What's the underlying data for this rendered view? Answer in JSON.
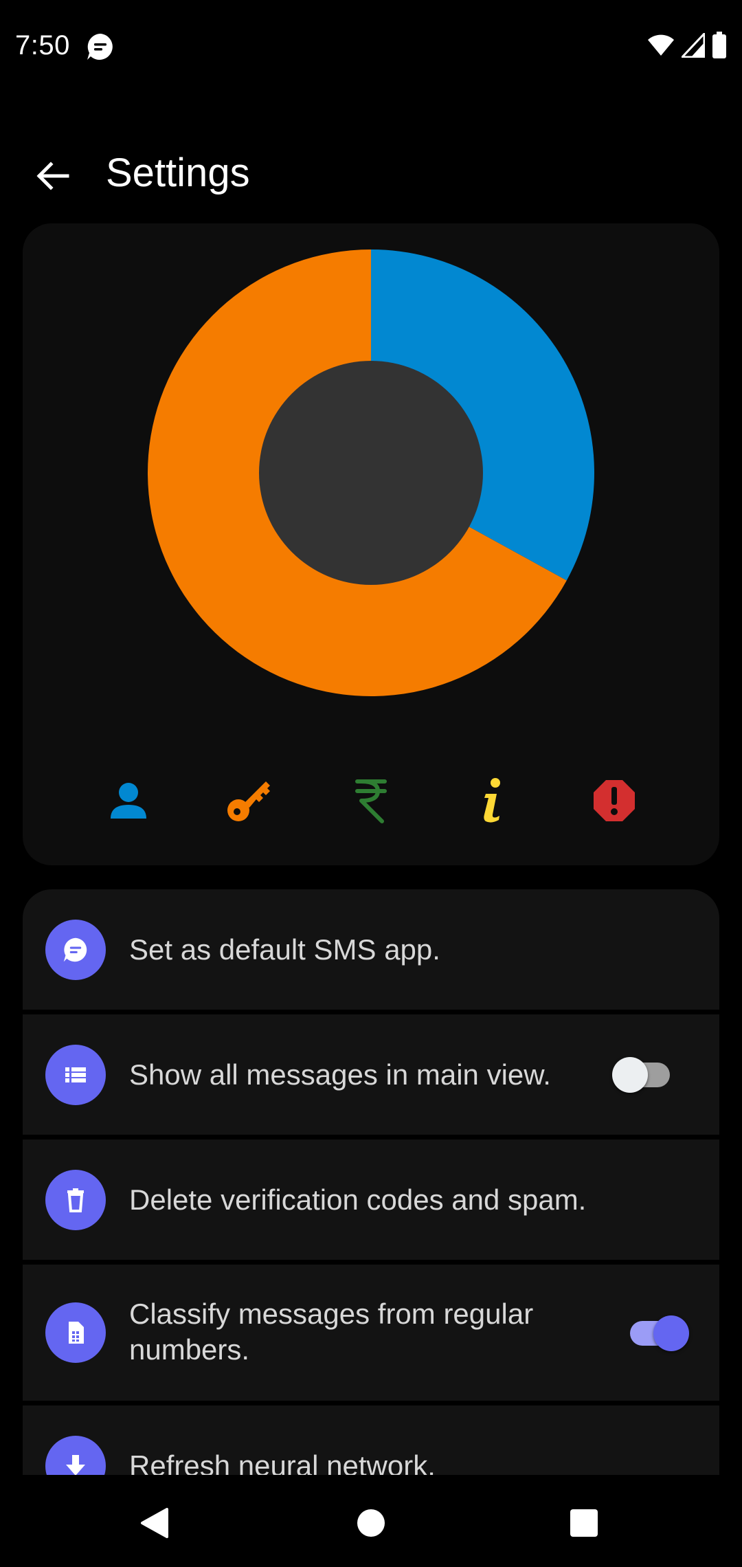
{
  "status_bar": {
    "time": "7:50",
    "icons": [
      "message-notification-icon",
      "wifi-icon",
      "cell-signal-icon",
      "battery-icon"
    ]
  },
  "app_bar": {
    "back_icon": "arrow-back-icon",
    "title": "Settings"
  },
  "chart_data": {
    "type": "pie",
    "style": "donut",
    "slices": [
      {
        "value": 33,
        "color": "#0288d1"
      },
      {
        "value": 67,
        "color": "#f57c00"
      }
    ],
    "hole_color": "#333333",
    "legend_icons": [
      {
        "icon": "person-icon",
        "color": "#0288d1"
      },
      {
        "icon": "key-icon",
        "color": "#f57c00"
      },
      {
        "icon": "rupee-icon",
        "color": "#2e7d32"
      },
      {
        "icon": "info-icon",
        "color": "#fdd835"
      },
      {
        "icon": "warning-octagon-icon",
        "color": "#d32f2f"
      }
    ]
  },
  "settings": {
    "accent_color": "#6466f1",
    "items": [
      {
        "icon": "message-icon",
        "label": "Set as default SMS app."
      },
      {
        "icon": "list-icon",
        "label": "Show all messages in main view.",
        "toggle": false
      },
      {
        "icon": "trash-icon",
        "label": "Delete verification codes and spam."
      },
      {
        "icon": "sim-card-icon",
        "label": "Classify messages from regular numbers.",
        "toggle": true
      },
      {
        "icon": "download-icon",
        "label": "Refresh neural network."
      }
    ]
  },
  "nav_bar": {
    "icons": [
      "back-triangle-icon",
      "home-circle-icon",
      "recents-square-icon"
    ]
  }
}
